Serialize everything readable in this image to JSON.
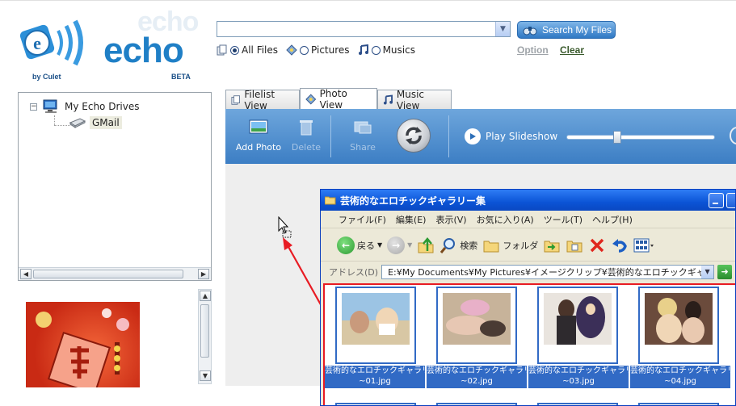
{
  "app": {
    "logo_ghost": "echo",
    "logo_word": "echo",
    "byline": "by Culet",
    "badge": "BETA"
  },
  "search": {
    "value": "",
    "button_label": "Search My Files",
    "filters": [
      {
        "label": "All Files",
        "selected": true
      },
      {
        "label": "Pictures",
        "selected": false
      },
      {
        "label": "Musics",
        "selected": false
      }
    ],
    "option_label": "Option",
    "clear_label": "Clear"
  },
  "tree": {
    "root_label": "My Echo Drives",
    "child_label": "GMail"
  },
  "tabs": [
    {
      "label": "Filelist View",
      "active": false
    },
    {
      "label": "Photo View",
      "active": true
    },
    {
      "label": "Music View",
      "active": false
    }
  ],
  "toolbar": {
    "add_label": "Add Photo",
    "delete_label": "Delete",
    "share_label": "Share",
    "slideshow_label": "Play Slideshow",
    "slider_value": 0.35
  },
  "explorer": {
    "title": "芸術的なエロチックギャラリー集",
    "menu": [
      "ファイル(F)",
      "編集(E)",
      "表示(V)",
      "お気に入り(A)",
      "ツール(T)",
      "ヘルプ(H)"
    ],
    "back_label": "戻る",
    "search_label": "検索",
    "folder_label": "フォルダ",
    "address_label": "アドレス(D)",
    "address_value": "E:¥My Documents¥My Pictures¥イメージクリップ¥芸術的なエロチックギャラリー集",
    "files": [
      {
        "line1": "芸術的なエロチックギャラリ",
        "line2": "~01.jpg"
      },
      {
        "line1": "芸術的なエロチックギャラリ",
        "line2": "~02.jpg"
      },
      {
        "line1": "芸術的なエロチックギャラリ",
        "line2": "~03.jpg"
      },
      {
        "line1": "芸術的なエロチックギャラリ",
        "line2": "~04.jpg"
      }
    ]
  },
  "colors": {
    "accent": "#1f7fc6",
    "toolbar": "#4f8fd0",
    "selection": "#316ac5",
    "highlight": "#e81b23"
  }
}
